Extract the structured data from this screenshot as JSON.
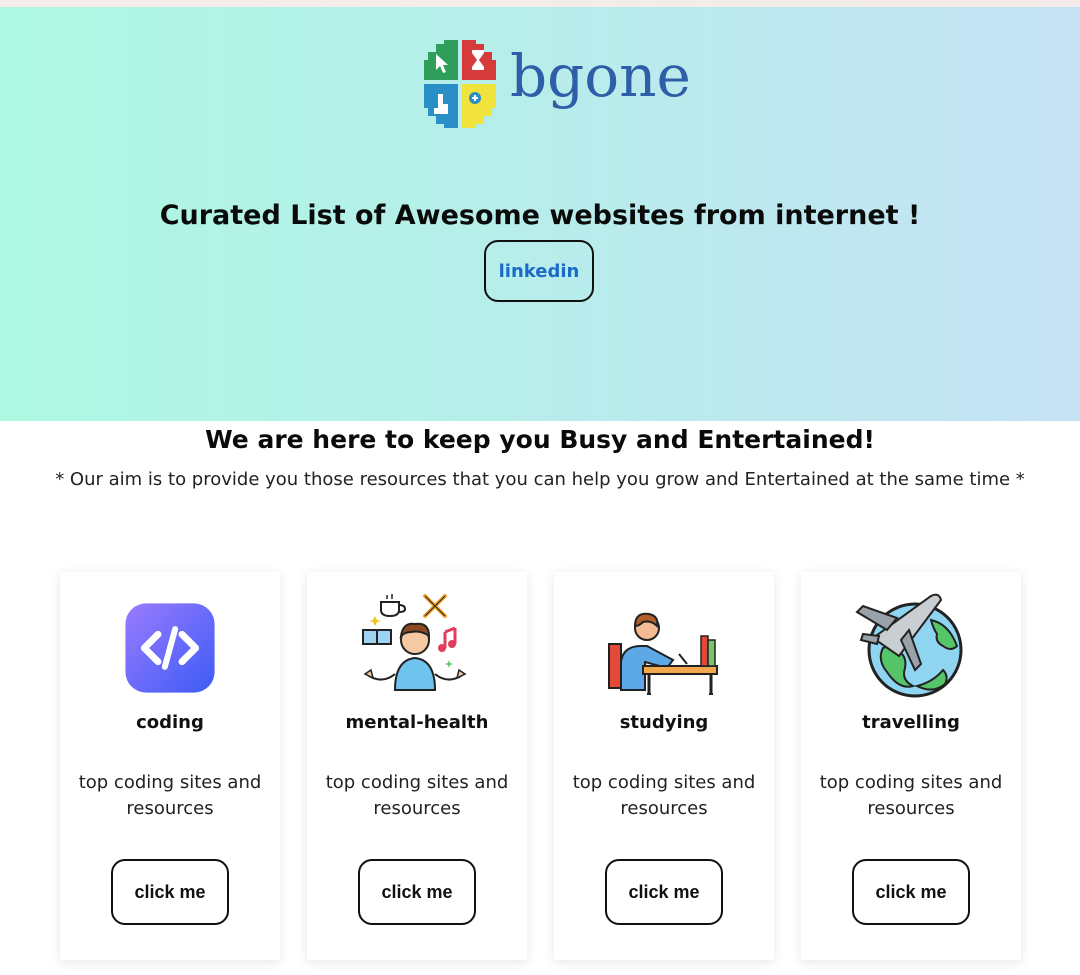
{
  "header": {
    "logo_text": "bgone",
    "title": "Curated List of Awesome websites from internet !",
    "linkedin_label": "linkedin"
  },
  "intro": {
    "tagline": "We are here to keep you Busy and Entertained!",
    "aim": "* Our aim is to provide you those resources that you can help you grow and Entertained at the same time *"
  },
  "cards": [
    {
      "title": "coding",
      "description": "top coding sites and resources",
      "button": "click me",
      "icon": "code-icon"
    },
    {
      "title": "mental-health",
      "description": "top coding sites and resources",
      "button": "click me",
      "icon": "meditation-icon"
    },
    {
      "title": "studying",
      "description": "top coding sites and resources",
      "button": "click me",
      "icon": "student-icon"
    },
    {
      "title": "travelling",
      "description": "top coding sites and resources",
      "button": "click me",
      "icon": "airplane-globe-icon"
    }
  ],
  "colors": {
    "hero_gradient_start": "#aef8e2",
    "hero_gradient_end": "#c5e2f4",
    "link_color": "#1b6ac9",
    "logo_text_color": "#2f5ea8"
  }
}
